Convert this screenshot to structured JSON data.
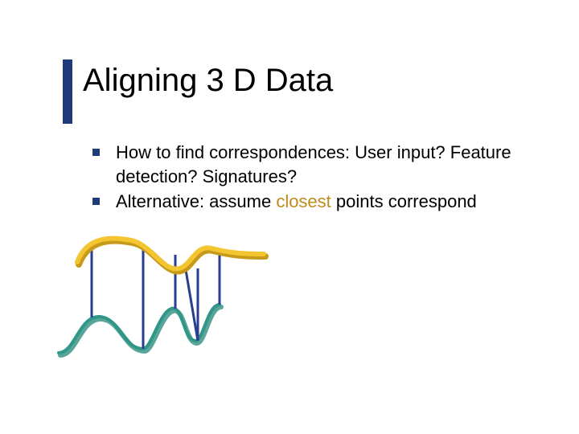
{
  "slide": {
    "title": "Aligning 3 D Data",
    "bullets": [
      {
        "text": "How to find correspondences:  User input? Feature detection?  Signatures?",
        "highlight_word": null
      },
      {
        "text_before": "Alternative: assume ",
        "highlight_word": "closest",
        "text_after": " points correspond"
      }
    ]
  }
}
